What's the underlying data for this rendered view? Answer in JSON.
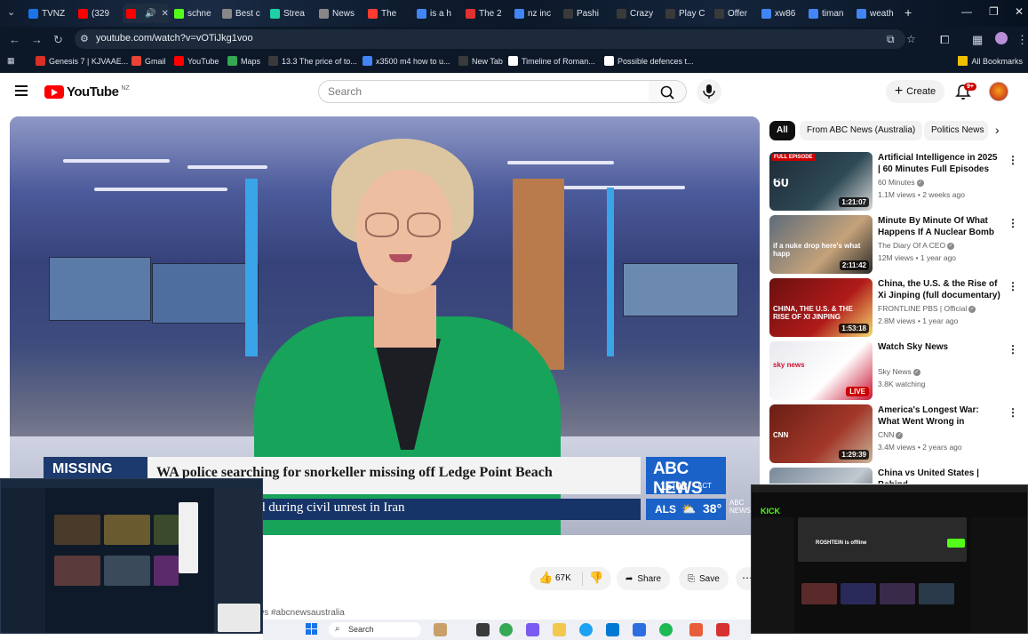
{
  "browser": {
    "tabs": [
      {
        "label": "TVNZ",
        "color": "#1a73e8"
      },
      {
        "label": "(329",
        "color": "#ff0000"
      },
      {
        "label": "",
        "color": "#ff0000"
      },
      {
        "label": "schne",
        "color": "#53fc18"
      },
      {
        "label": "Best c",
        "color": "#888888"
      },
      {
        "label": "Strea",
        "color": "#1fd1a5"
      },
      {
        "label": "News",
        "color": "#888888"
      },
      {
        "label": "The",
        "color": "#ff3b30"
      },
      {
        "label": "is a h",
        "color": "#4285f4"
      },
      {
        "label": "The 2",
        "color": "#e03131"
      },
      {
        "label": "nz inc",
        "color": "#4285f4"
      },
      {
        "label": "Pashi",
        "color": "#3a3a3a"
      },
      {
        "label": "Crazy",
        "color": "#3a3a3a"
      },
      {
        "label": "Play C",
        "color": "#3a3a3a"
      },
      {
        "label": "Offer",
        "color": "#3a3a3a"
      },
      {
        "label": "xw86",
        "color": "#4285f4"
      },
      {
        "label": "timan",
        "color": "#4285f4"
      },
      {
        "label": "weath",
        "color": "#4285f4"
      }
    ],
    "url": "youtube.com/watch?v=vOTiJkg1voo",
    "bookmarks": [
      {
        "label": "Genesis 7 | KJVAAE...",
        "color": "#d93025"
      },
      {
        "label": "Gmail",
        "color": "#ea4335"
      },
      {
        "label": "YouTube",
        "color": "#ff0000"
      },
      {
        "label": "Maps",
        "color": "#34a853"
      },
      {
        "label": "13.3 The price of to...",
        "color": "#3a3a3a"
      },
      {
        "label": "x3500 m4 how to u...",
        "color": "#4285f4"
      },
      {
        "label": "New Tab",
        "color": "#3a3a3a"
      },
      {
        "label": "Timeline of Roman...",
        "color": "#ffffff"
      },
      {
        "label": "Possible defences t...",
        "color": "#ffffff"
      }
    ],
    "all_bookmarks": "All Bookmarks"
  },
  "youtube": {
    "logo_text": "YouTube",
    "country": "NZ",
    "search_placeholder": "Search",
    "create_label": "Create",
    "notifications_badge": "9+"
  },
  "video": {
    "tag": "MISSING",
    "headline": "WA police searching for snorkeller missing off Ledge Point Beach",
    "ticker": "d during civil unrest in Iran",
    "network": "ABC NEWS",
    "time": "15:03",
    "time_zone": "ACT",
    "weather_place": "ALS",
    "temperature": "38°",
    "watermark": "ABC NEWS"
  },
  "actions": {
    "likes": "67K",
    "share": "Share",
    "save": "Save",
    "hashtag": "ws #abcnewsaustralia"
  },
  "chips": [
    "All",
    "From ABC News (Australia)",
    "Politics News"
  ],
  "recommendations": [
    {
      "title": "Artificial Intelligence in 2025 | 60 Minutes Full Episodes",
      "channel": "60 Minutes",
      "verified": true,
      "meta": "1.1M views • 2 weeks ago",
      "duration": "1:21:07",
      "badge": "FULL EPISODE",
      "thumb_colors": [
        "#1e2a36",
        "#2e4a56",
        "#d8d8d8"
      ],
      "thumb_text": "60"
    },
    {
      "title": "Minute By Minute Of What Happens If A Nuclear Bomb ...",
      "channel": "The Diary Of A CEO",
      "verified": true,
      "meta": "12M views • 1 year ago",
      "duration": "2:11:42",
      "badge": "",
      "thumb_colors": [
        "#5d6c7a",
        "#c5a27a",
        "#2a2a2a"
      ],
      "thumb_text": "if a nuke drop here's what happ"
    },
    {
      "title": "China, the U.S. & the Rise of Xi Jinping (full documentary) | ...",
      "channel": "FRONTLINE PBS | Official",
      "verified": true,
      "meta": "2.8M views • 1 year ago",
      "duration": "1:53:18",
      "badge": "",
      "thumb_colors": [
        "#6a1010",
        "#b01a1a",
        "#f5d76e"
      ],
      "thumb_text": "CHINA, THE U.S. & THE RISE OF XI JINPING"
    },
    {
      "title": "Watch Sky News",
      "channel": "Sky News",
      "verified": true,
      "meta": "3.8K watching",
      "duration": "LIVE",
      "badge": "",
      "thumb_colors": [
        "#e8e8ee",
        "#ffffff",
        "#c81432"
      ],
      "thumb_text": "sky news"
    },
    {
      "title": "America's Longest War: What Went Wrong in Afghanistan ...",
      "channel": "CNN",
      "verified": true,
      "meta": "3.4M views • 2 years ago",
      "duration": "1:29:39",
      "badge": "",
      "thumb_colors": [
        "#6a1e14",
        "#a2382a",
        "#c9b59a"
      ],
      "thumb_text": "CNN"
    },
    {
      "title": "China vs United States | Behind ...",
      "channel": "",
      "verified": false,
      "meta": "",
      "duration": "",
      "badge": "",
      "thumb_colors": [
        "#7a8a9a",
        "#c0c8d0",
        "#3a3a3a"
      ],
      "thumb_text": ""
    }
  ],
  "overlays": {
    "kick_channel": "ROSHTEIN is offline",
    "kick_logo": "KICK"
  },
  "taskbar": {
    "search_label": "Search"
  }
}
